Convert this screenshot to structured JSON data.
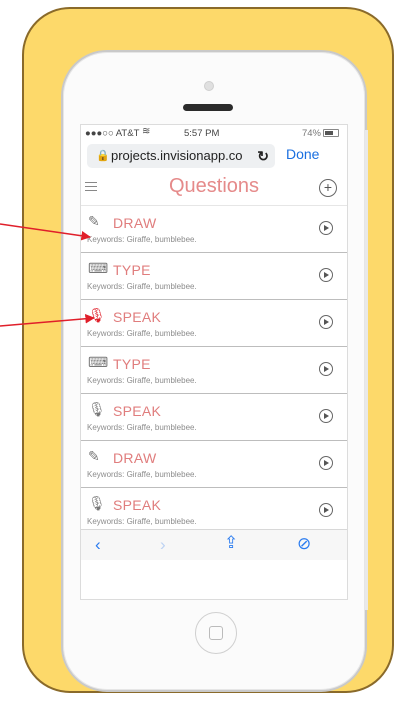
{
  "status": {
    "carrier": "●●●○○ AT&T",
    "wifi": "wifi-icon",
    "time": "5:57 PM",
    "battery": "74%"
  },
  "browser": {
    "url": "projects.invisionapp.co",
    "done_label": "Done"
  },
  "app": {
    "title": "Questions"
  },
  "rows": [
    {
      "icon": "pencil-icon",
      "label": "DRAW",
      "keywords": "Keywords: Giraffe, bumblebee."
    },
    {
      "icon": "keyboard-icon",
      "label": "TYPE",
      "keywords": "Keywords: Giraffe, bumblebee."
    },
    {
      "icon": "microphone-icon",
      "label": "SPEAK",
      "keywords": "Keywords: Giraffe, bumblebee."
    },
    {
      "icon": "keyboard-icon",
      "label": "TYPE",
      "keywords": "Keywords: Giraffe, bumblebee."
    },
    {
      "icon": "microphone-icon",
      "label": "SPEAK",
      "keywords": "Keywords: Giraffe, bumblebee."
    },
    {
      "icon": "pencil-icon",
      "label": "DRAW",
      "keywords": "Keywords: Giraffe, bumblebee."
    },
    {
      "icon": "microphone-icon",
      "label": "SPEAK",
      "keywords": "Keywords: Giraffe, bumblebee."
    }
  ],
  "colors": {
    "accent": "#e07d7d",
    "annotation": "#e01f2a",
    "backdrop": "#fdd96a",
    "link": "#1a6fe0"
  }
}
